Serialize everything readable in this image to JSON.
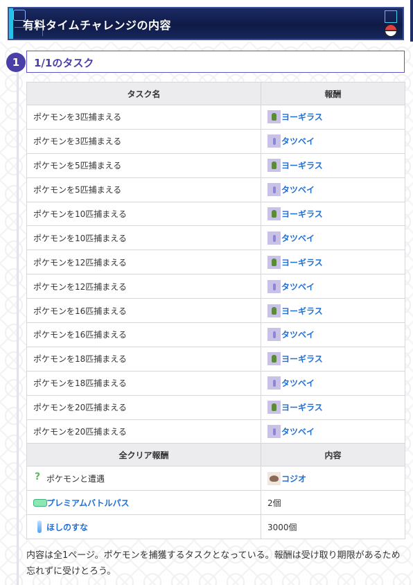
{
  "header": {
    "title": "有料タイムチャレンジの内容"
  },
  "step": {
    "number": "1",
    "title": "1/1のタスク"
  },
  "task_table": {
    "headers": [
      "タスク名",
      "報酬"
    ],
    "rows": [
      {
        "task": "ポケモンを3匹捕まえる",
        "reward": "ヨーギラス",
        "icon": "larvitar-icon"
      },
      {
        "task": "ポケモンを3匹捕まえる",
        "reward": "タツベイ",
        "icon": "dreepy-icon"
      },
      {
        "task": "ポケモンを5匹捕まえる",
        "reward": "ヨーギラス",
        "icon": "larvitar-icon"
      },
      {
        "task": "ポケモンを5匹捕まえる",
        "reward": "タツベイ",
        "icon": "dreepy-icon"
      },
      {
        "task": "ポケモンを10匹捕まえる",
        "reward": "ヨーギラス",
        "icon": "larvitar-icon"
      },
      {
        "task": "ポケモンを10匹捕まえる",
        "reward": "タツベイ",
        "icon": "dreepy-icon"
      },
      {
        "task": "ポケモンを12匹捕まえる",
        "reward": "ヨーギラス",
        "icon": "larvitar-icon"
      },
      {
        "task": "ポケモンを12匹捕まえる",
        "reward": "タツベイ",
        "icon": "dreepy-icon"
      },
      {
        "task": "ポケモンを16匹捕まえる",
        "reward": "ヨーギラス",
        "icon": "larvitar-icon"
      },
      {
        "task": "ポケモンを16匹捕まえる",
        "reward": "タツベイ",
        "icon": "dreepy-icon"
      },
      {
        "task": "ポケモンを18匹捕まえる",
        "reward": "ヨーギラス",
        "icon": "larvitar-icon"
      },
      {
        "task": "ポケモンを18匹捕まえる",
        "reward": "タツベイ",
        "icon": "dreepy-icon"
      },
      {
        "task": "ポケモンを20匹捕まえる",
        "reward": "ヨーギラス",
        "icon": "larvitar-icon"
      },
      {
        "task": "ポケモンを20匹捕まえる",
        "reward": "タツベイ",
        "icon": "dreepy-icon"
      }
    ]
  },
  "clear_table": {
    "headers": [
      "全クリア報酬",
      "内容"
    ],
    "rows": [
      {
        "name": "ポケモンと遭遇",
        "name_is_link": false,
        "name_icon": "encounter-icon",
        "content": "コジオ",
        "content_is_link": true,
        "content_icon": "nacli-icon"
      },
      {
        "name": "プレミアムバトルパス",
        "name_is_link": true,
        "name_icon": "battle-pass-icon",
        "content": "2個",
        "content_is_link": false
      },
      {
        "name": "ほしのすな",
        "name_is_link": true,
        "name_icon": "stardust-icon",
        "content": "3000個",
        "content_is_link": false
      }
    ]
  },
  "description": "内容は全1ページ。ポケモンを捕獲するタスクとなっている。報酬は受け取り期限があるため忘れずに受けとろう。",
  "colors": {
    "accent": "#4a3fa6",
    "link": "#1f6fd6",
    "header_bg": "#0f1a46"
  }
}
